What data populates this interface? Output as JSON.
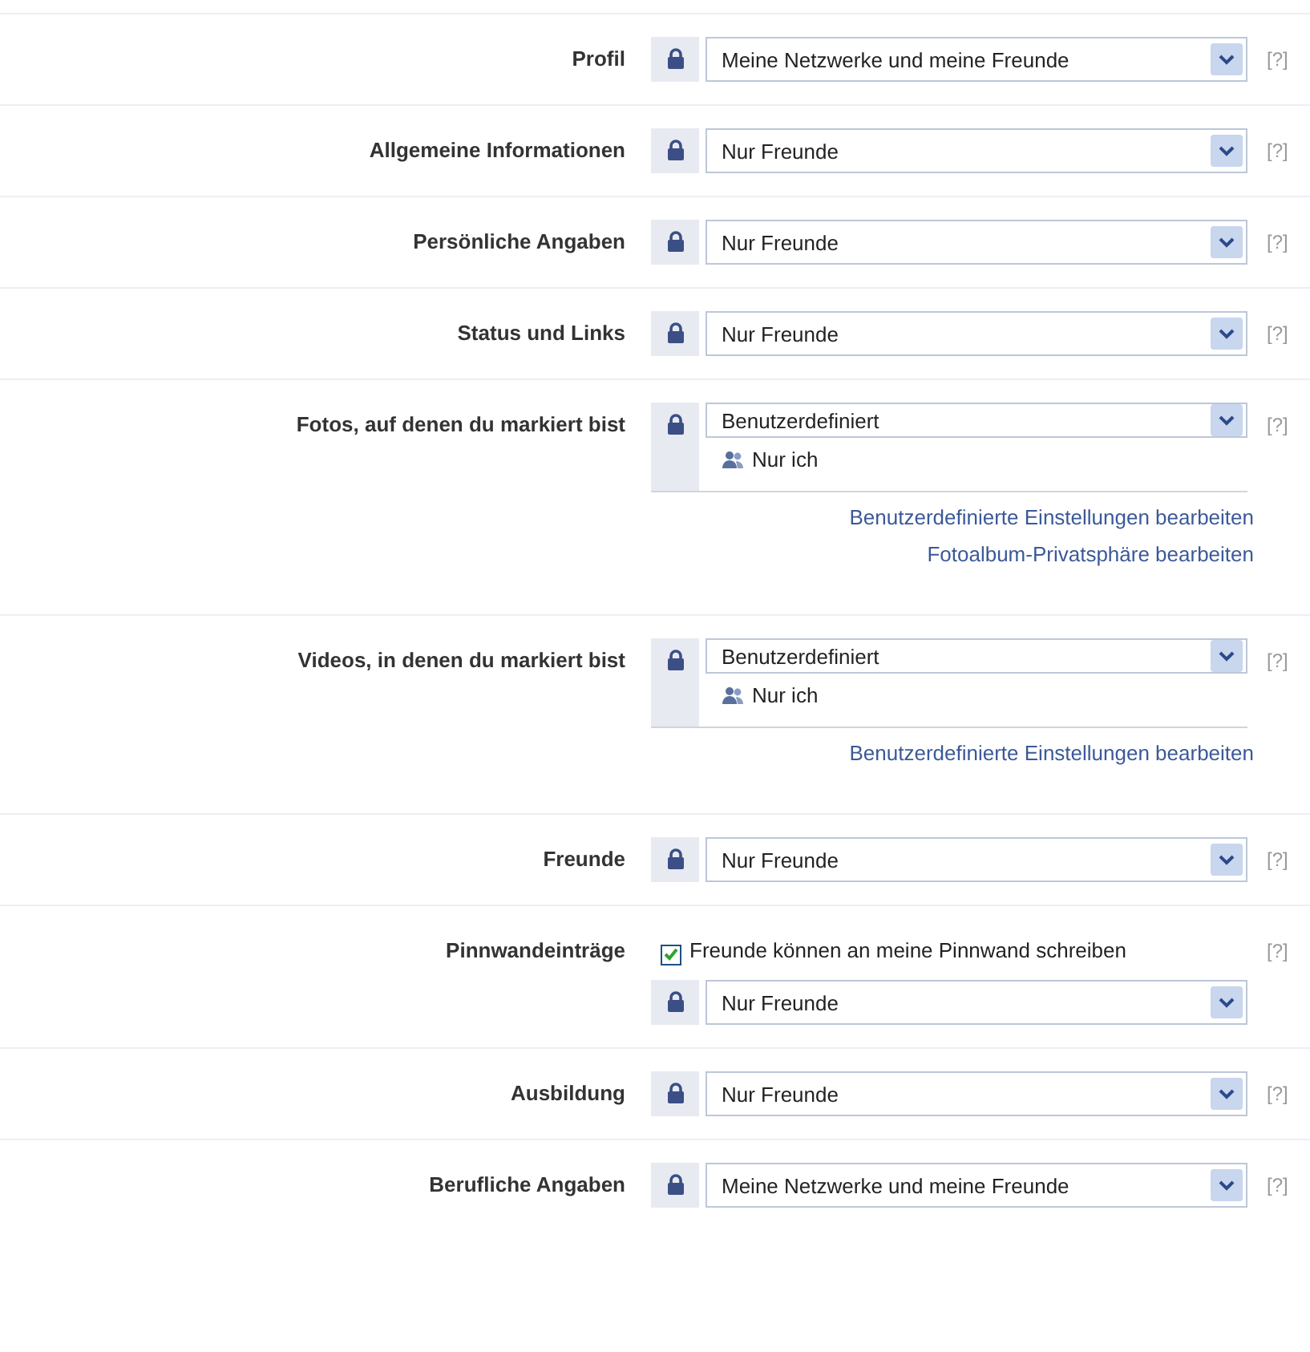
{
  "rows": [
    {
      "label": "Profil",
      "kind": "select",
      "value": "Meine Netzwerke und meine Freunde",
      "help": "[?]"
    },
    {
      "label": "Allgemeine Informationen",
      "kind": "select",
      "value": "Nur Freunde",
      "help": "[?]"
    },
    {
      "label": "Persönliche Angaben",
      "kind": "select",
      "value": "Nur Freunde",
      "help": "[?]"
    },
    {
      "label": "Status und Links",
      "kind": "select",
      "value": "Nur Freunde",
      "help": "[?]"
    },
    {
      "label": "Fotos, auf denen du markiert bist",
      "kind": "custom",
      "value": "Benutzerdefiniert",
      "audience": "Nur ich",
      "links": [
        "Benutzerdefinierte Einstellungen bearbeiten",
        "Fotoalbum-Privatsphäre bearbeiten"
      ],
      "help": "[?]"
    },
    {
      "label": "Videos, in denen du markiert bist",
      "kind": "custom",
      "value": "Benutzerdefiniert",
      "audience": "Nur ich",
      "links": [
        "Benutzerdefinierte Einstellungen bearbeiten"
      ],
      "help": "[?]"
    },
    {
      "label": "Freunde",
      "kind": "select",
      "value": "Nur Freunde",
      "help": "[?]"
    },
    {
      "label": "Pinnwandeinträge",
      "kind": "wall",
      "checkbox": {
        "label": "Freunde können an meine Pinnwand schreiben",
        "checked": true
      },
      "value": "Nur Freunde",
      "help": "[?]"
    },
    {
      "label": "Ausbildung",
      "kind": "select",
      "value": "Nur Freunde",
      "help": "[?]"
    },
    {
      "label": "Berufliche Angaben",
      "kind": "select",
      "value": "Meine Netzwerke und meine Freunde",
      "help": "[?]"
    }
  ]
}
